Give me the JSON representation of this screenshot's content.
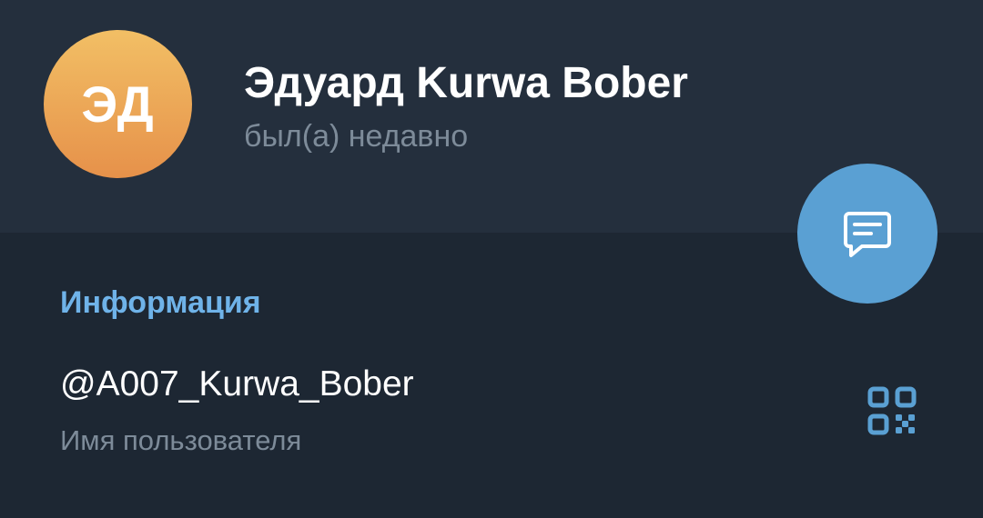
{
  "profile": {
    "initials": "ЭД",
    "name": "Эдуард Kurwa Bober",
    "status": "был(а) недавно",
    "avatar_gradient": [
      "#f2bf65",
      "#e6914a"
    ]
  },
  "actions": {
    "message_icon": "message-icon",
    "qr_icon": "qr-code-icon"
  },
  "info": {
    "section_title": "Информация",
    "username": "@A007_Kurwa_Bober",
    "username_caption": "Имя пользователя"
  },
  "colors": {
    "background": "#1d2733",
    "header_background": "#242f3d",
    "accent": "#5aa0d3",
    "section_title": "#6fb3e9",
    "secondary_text": "#7d8b99"
  }
}
